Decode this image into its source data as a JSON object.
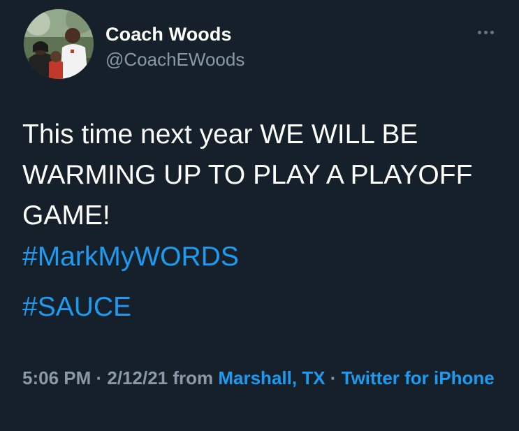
{
  "user": {
    "display_name": "Coach Woods",
    "handle": "@CoachEWoods"
  },
  "more_icon": "more-horizontal-icon",
  "tweet": {
    "text_lines": [
      "This time next year WE WILL BE",
      "WARMING UP TO PLAY A PLAYOFF",
      "GAME!"
    ],
    "hashtags": [
      "#MarkMyWORDS",
      "#SAUCE"
    ]
  },
  "meta": {
    "time": "5:06 PM",
    "separator": " · ",
    "date": "2/12/21",
    "from_label": " from ",
    "location": "Marshall, TX",
    "source": "Twitter for iPhone"
  },
  "colors": {
    "background": "#15202b",
    "primary_text": "#ffffff",
    "secondary_text": "#8b98a5",
    "link": "#1d9bf0"
  }
}
